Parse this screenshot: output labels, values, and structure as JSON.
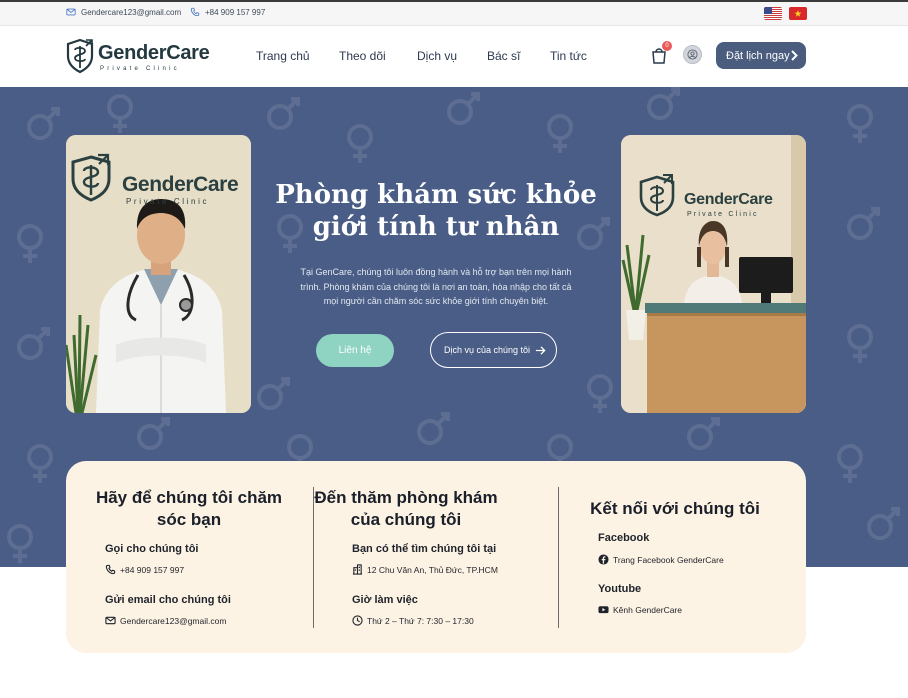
{
  "topbar": {
    "email": "Gendercare123@gmail.com",
    "phone": "+84 909 157 997",
    "flags": [
      "us-flag",
      "vn-flag"
    ]
  },
  "header": {
    "logo_name": "GenderCare",
    "logo_sub": "Private Clinic",
    "nav": [
      "Trang chủ",
      "Theo dõi",
      "Dịch vụ",
      "Bác sĩ",
      "Tin tức"
    ],
    "cart_count": "0",
    "book_label": "Đặt lịch ngay"
  },
  "hero": {
    "title_line1": "Phòng khám sức khỏe",
    "title_line2": "giới tính tư nhân",
    "description": "Tại GenCare, chúng tôi luôn đồng hành và hỗ trợ bạn trên mọi hành trình. Phòng khám của chúng tôi là nơi an toàn, hòa nhập cho tất cả mọi người cần chăm sóc sức khỏe giới tính chuyên biệt.",
    "contact_button": "Liên hệ",
    "services_button": "Dịch vụ của chúng tôi",
    "left_photo_logo": "GenderCare",
    "left_photo_sub": "Private Clinic",
    "right_photo_logo": "GenderCare",
    "right_photo_sub": "Private Clinic"
  },
  "info": {
    "col1": {
      "title_line1": "Hãy để chúng tôi chăm",
      "title_line2": "sóc bạn",
      "call_heading": "Gọi cho chúng tôi",
      "call_value": "+84 909 157 997",
      "email_heading": "Gửi email cho chúng tôi",
      "email_value": "Gendercare123@gmail.com"
    },
    "col2": {
      "title_line1": "Đến thăm phòng khám",
      "title_line2": "của chúng tôi",
      "address_heading": "Bạn có thể tìm chúng tôi tại",
      "address_value": "12 Chu Văn An, Thủ Đức, TP.HCM",
      "hours_heading": "Giờ làm việc",
      "hours_value": "Thứ 2 – Thứ 7: 7:30 – 17:30"
    },
    "col3": {
      "title": "Kết nối với chúng tôi",
      "facebook_heading": "Facebook",
      "facebook_value": "Trang Facebook GenderCare",
      "youtube_heading": "Youtube",
      "youtube_value": "Kênh GenderCare"
    }
  },
  "colors": {
    "hero_bg": "#4a5d86",
    "accent_teal": "#8fd3c3",
    "button_dark": "#4a5d7e",
    "card_bg": "#fdf3e4"
  }
}
